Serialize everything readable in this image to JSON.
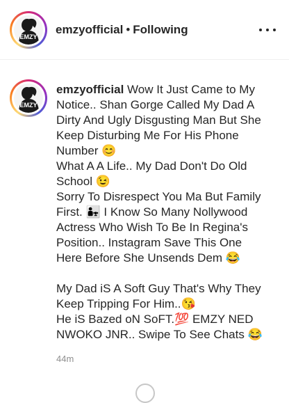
{
  "header": {
    "username": "emzyofficial",
    "separator": "•",
    "follow_status": "Following",
    "avatar_text": "EMZY"
  },
  "post": {
    "username": "emzyofficial",
    "caption_lines": [
      "Wow It Just Came to My",
      "Notice.. Shan Gorge Called My Dad A",
      "Dirty And Ugly Disgusting Man But She",
      "Keep Disturbing Me For His Phone",
      "Number 😊",
      "What A A Life.. My Dad Don't Do Old",
      "School 😉",
      "Sorry To Disrespect You Ma But Family",
      "First. 👨‍👧 I Know So Many Nollywood",
      "Actress Who Wish To Be In Regina's",
      "Position.. Instagram Save This One",
      "Here Before She Unsends Dem 😂",
      "",
      "My Dad iS A Soft Guy That's Why They",
      "Keep Tripping For Him..😘",
      "He iS Bazed oN SoFT.💯 EMZY NED",
      "NWOKO JNR.. Swipe To See Chats 😂"
    ],
    "time": "44m"
  },
  "icons": {
    "more": "more-options-icon",
    "avatar": "avatar-silhouette"
  },
  "colors": {
    "text": "#262626",
    "muted": "#8e8e8e",
    "divider": "#efefef"
  }
}
